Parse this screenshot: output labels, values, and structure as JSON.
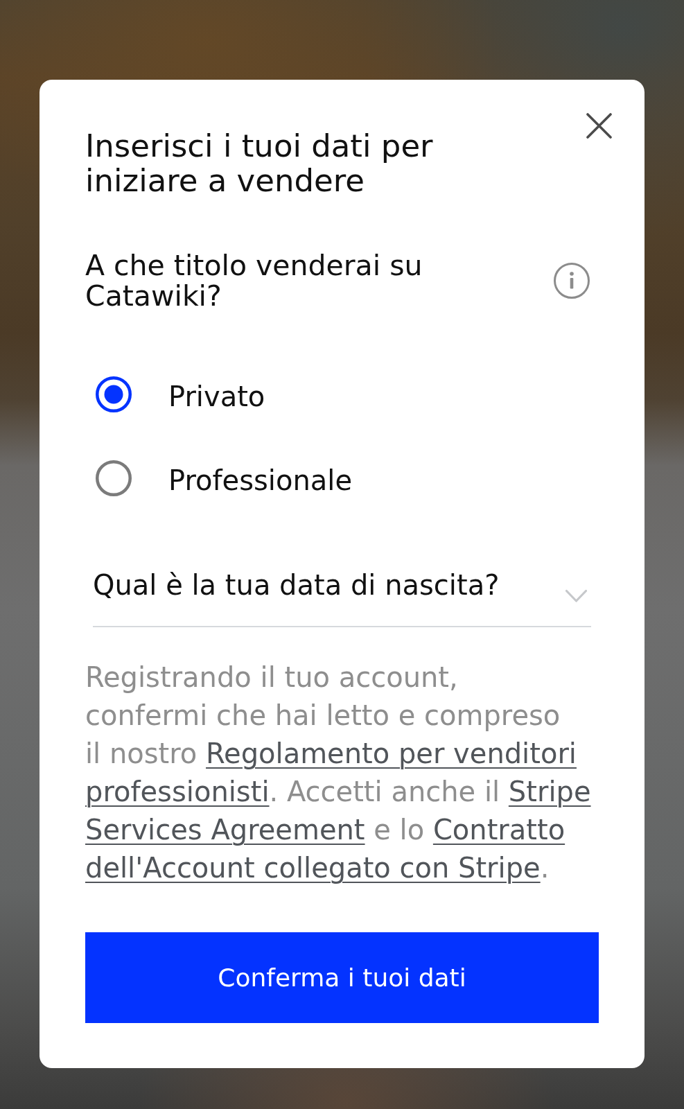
{
  "dialog": {
    "title": "Inserisci i tuoi dati per iniziare a vendere"
  },
  "seller_type": {
    "question": "A che titolo venderai su Catawiki?",
    "options": [
      {
        "label": "Privato",
        "selected": true
      },
      {
        "label": "Professionale",
        "selected": false
      }
    ]
  },
  "birthdate_field": {
    "label": "Qual è la tua data di nascita?",
    "expanded": false
  },
  "consent": [
    {
      "kind": "text",
      "text": "Registrando il tuo account,\nconfermi che hai letto e compreso\nil nostro "
    },
    {
      "kind": "link",
      "lines": [
        "Regolamento per venditori",
        "professionisti"
      ]
    },
    {
      "kind": "text",
      "text": ". Accetti anche il "
    },
    {
      "kind": "link",
      "lines": [
        "Stripe",
        "Services Agreement"
      ]
    },
    {
      "kind": "text",
      "text": " e lo "
    },
    {
      "kind": "link",
      "lines": [
        "Contratto",
        "dell'Account collegato con Stripe"
      ]
    },
    {
      "kind": "text",
      "text": "."
    }
  ],
  "confirm_button": {
    "label": "Conferma i tuoi dati"
  }
}
